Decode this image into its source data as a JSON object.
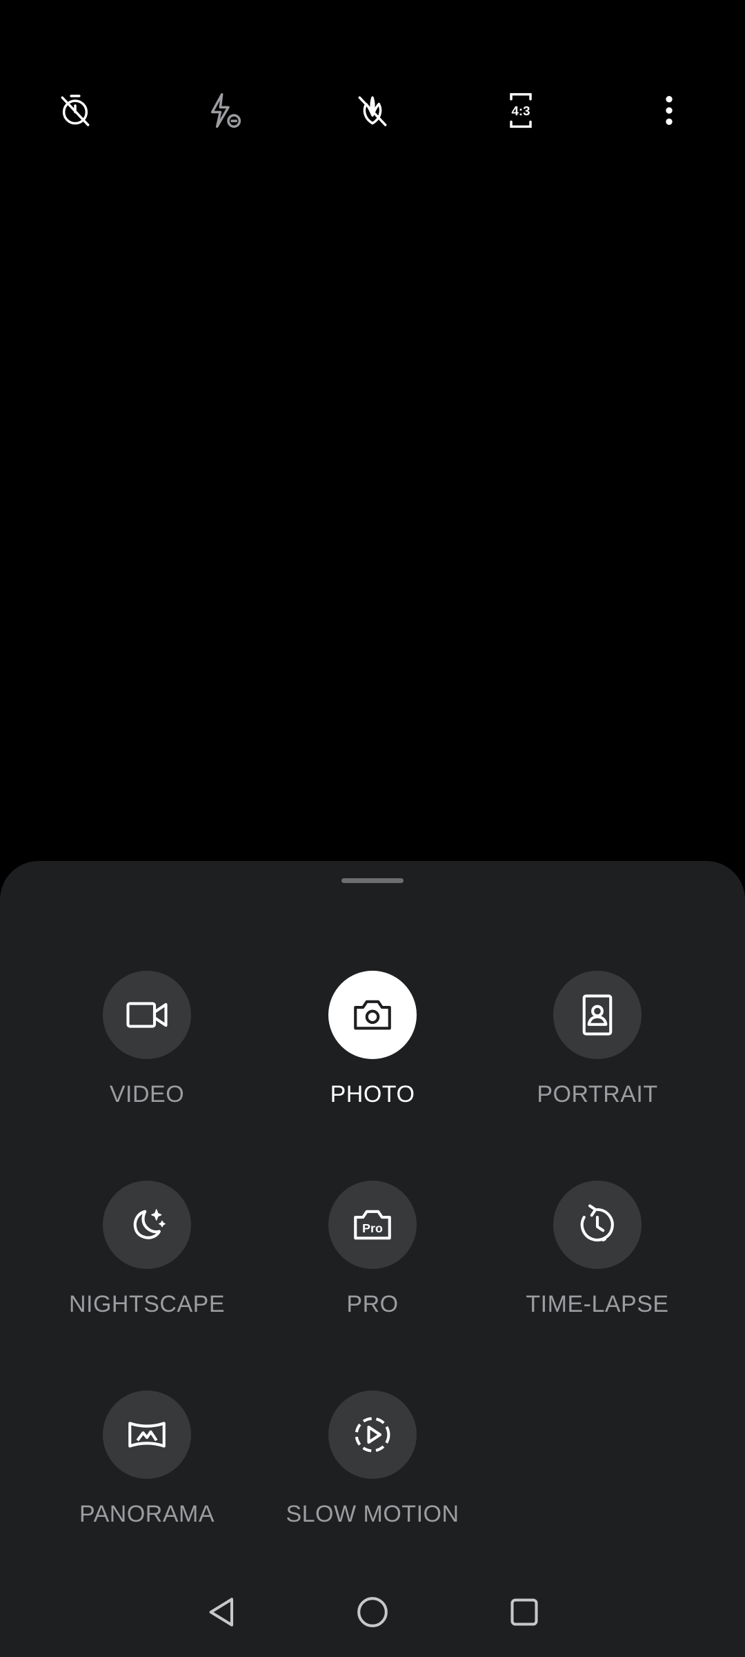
{
  "toolbar": {
    "items": [
      {
        "name": "timer-off",
        "icon": "timer-off-icon"
      },
      {
        "name": "flash-auto",
        "icon": "flash-icon"
      },
      {
        "name": "filter-off",
        "icon": "filter-off-icon"
      },
      {
        "name": "aspect-ratio",
        "icon": "aspect-ratio-icon",
        "label": "4:3"
      },
      {
        "name": "more-options",
        "icon": "more-vertical-icon"
      }
    ]
  },
  "modes": [
    {
      "label": "VIDEO",
      "icon": "video-camera-icon",
      "selected": false
    },
    {
      "label": "PHOTO",
      "icon": "camera-icon",
      "selected": true
    },
    {
      "label": "PORTRAIT",
      "icon": "portrait-icon",
      "selected": false
    },
    {
      "label": "NIGHTSCAPE",
      "icon": "moon-stars-icon",
      "selected": false
    },
    {
      "label": "PRO",
      "icon": "pro-camera-icon",
      "badge": "Pro",
      "selected": false
    },
    {
      "label": "TIME-LAPSE",
      "icon": "time-lapse-icon",
      "selected": false
    },
    {
      "label": "PANORAMA",
      "icon": "panorama-icon",
      "selected": false
    },
    {
      "label": "SLOW MOTION",
      "icon": "slow-motion-icon",
      "selected": false
    }
  ],
  "colors": {
    "sheet_bg": "#1e1f21",
    "circle_bg": "#38393b",
    "active_circle_bg": "#ffffff",
    "label": "#9c9da0",
    "active_label": "#ffffff"
  }
}
